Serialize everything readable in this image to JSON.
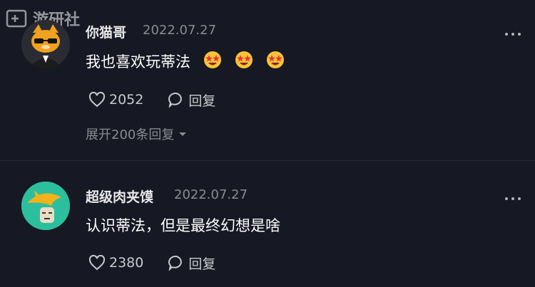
{
  "watermark": {
    "text": "游研社"
  },
  "comments": [
    {
      "username": "你猫哥",
      "date": "2022.07.27",
      "text": "我也喜欢玩蒂法",
      "emojis": [
        "star-struck-emoji",
        "star-struck-emoji",
        "star-struck-emoji"
      ],
      "likes": "2052",
      "reply_label": "回复",
      "expand_label": "展开200条回复"
    },
    {
      "username": "超级肉夹馍",
      "date": "2022.07.27",
      "text": "认识蒂法，但是最终幻想是啥",
      "likes": "2380",
      "reply_label": "回复"
    }
  ],
  "colors": {
    "background": "#161823",
    "secondary_text": "#8a8b91",
    "avatar2_bg": "#2bbf9e"
  }
}
